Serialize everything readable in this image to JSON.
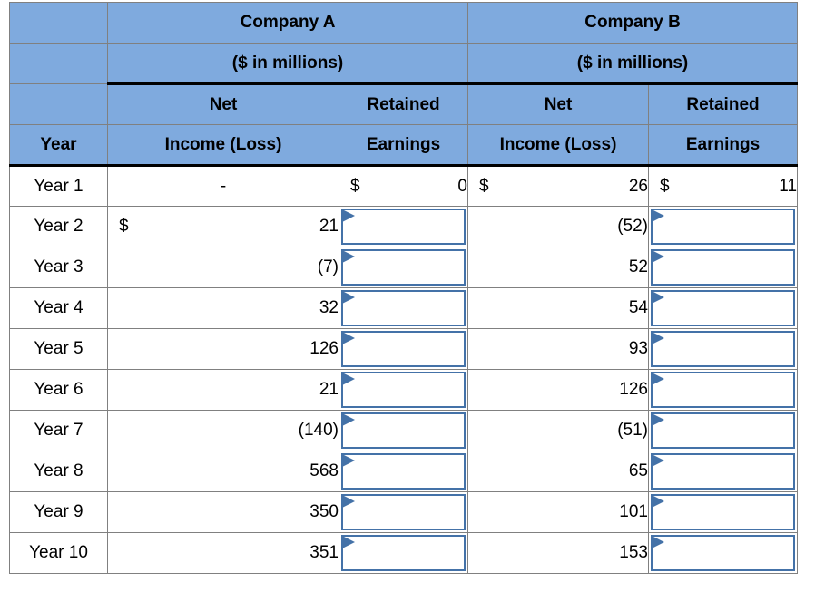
{
  "table": {
    "company_headers": [
      {
        "label": "Company A",
        "colspan": 2
      },
      {
        "label": "Company B",
        "colspan": 2
      }
    ],
    "units_headers": [
      {
        "label": "($ in millions)",
        "colspan": 2
      },
      {
        "label": "($ in millions)",
        "colspan": 2
      }
    ],
    "subheader_line1": [
      "Net",
      "Retained",
      "Net",
      "Retained"
    ],
    "subheader_line2": [
      "Income (Loss)",
      "Earnings",
      "Income (Loss)",
      "Earnings"
    ],
    "year_header": "Year",
    "rows": [
      {
        "year": "Year 1",
        "a_net_income": "-",
        "a_net_income_currency": "",
        "a_net_income_center": true,
        "a_retained": "0",
        "a_retained_currency": "$",
        "a_retained_is_input": false,
        "b_net_income": "26",
        "b_net_income_currency": "$",
        "b_retained": "11",
        "b_retained_currency": "$",
        "b_retained_is_input": false
      },
      {
        "year": "Year 2",
        "a_net_income": "21",
        "a_net_income_currency": "$",
        "a_net_income_center": false,
        "a_retained": "",
        "a_retained_currency": "",
        "a_retained_is_input": true,
        "b_net_income": "(52)",
        "b_net_income_currency": "",
        "b_retained": "",
        "b_retained_currency": "",
        "b_retained_is_input": true
      },
      {
        "year": "Year 3",
        "a_net_income": "(7)",
        "a_net_income_currency": "",
        "a_net_income_center": false,
        "a_retained": "",
        "a_retained_currency": "",
        "a_retained_is_input": true,
        "b_net_income": "52",
        "b_net_income_currency": "",
        "b_retained": "",
        "b_retained_currency": "",
        "b_retained_is_input": true
      },
      {
        "year": "Year 4",
        "a_net_income": "32",
        "a_net_income_currency": "",
        "a_net_income_center": false,
        "a_retained": "",
        "a_retained_currency": "",
        "a_retained_is_input": true,
        "b_net_income": "54",
        "b_net_income_currency": "",
        "b_retained": "",
        "b_retained_currency": "",
        "b_retained_is_input": true
      },
      {
        "year": "Year 5",
        "a_net_income": "126",
        "a_net_income_currency": "",
        "a_net_income_center": false,
        "a_retained": "",
        "a_retained_currency": "",
        "a_retained_is_input": true,
        "b_net_income": "93",
        "b_net_income_currency": "",
        "b_retained": "",
        "b_retained_currency": "",
        "b_retained_is_input": true
      },
      {
        "year": "Year 6",
        "a_net_income": "21",
        "a_net_income_currency": "",
        "a_net_income_center": false,
        "a_retained": "",
        "a_retained_currency": "",
        "a_retained_is_input": true,
        "b_net_income": "126",
        "b_net_income_currency": "",
        "b_retained": "",
        "b_retained_currency": "",
        "b_retained_is_input": true
      },
      {
        "year": "Year 7",
        "a_net_income": "(140)",
        "a_net_income_currency": "",
        "a_net_income_center": false,
        "a_retained": "",
        "a_retained_currency": "",
        "a_retained_is_input": true,
        "b_net_income": "(51)",
        "b_net_income_currency": "",
        "b_retained": "",
        "b_retained_currency": "",
        "b_retained_is_input": true
      },
      {
        "year": "Year 8",
        "a_net_income": "568",
        "a_net_income_currency": "",
        "a_net_income_center": false,
        "a_retained": "",
        "a_retained_currency": "",
        "a_retained_is_input": true,
        "b_net_income": "65",
        "b_net_income_currency": "",
        "b_retained": "",
        "b_retained_currency": "",
        "b_retained_is_input": true
      },
      {
        "year": "Year 9",
        "a_net_income": "350",
        "a_net_income_currency": "",
        "a_net_income_center": false,
        "a_retained": "",
        "a_retained_currency": "",
        "a_retained_is_input": true,
        "b_net_income": "101",
        "b_net_income_currency": "",
        "b_retained": "",
        "b_retained_currency": "",
        "b_retained_is_input": true
      },
      {
        "year": "Year 10",
        "a_net_income": "351",
        "a_net_income_currency": "",
        "a_net_income_center": false,
        "a_retained": "",
        "a_retained_currency": "",
        "a_retained_is_input": true,
        "b_net_income": "153",
        "b_net_income_currency": "",
        "b_retained": "",
        "b_retained_currency": "",
        "b_retained_is_input": true
      }
    ]
  },
  "colors": {
    "header_fill": "#7FAADE",
    "grid_line": "#808080",
    "rule": "#000000",
    "input_border": "#4472A8",
    "input_flag": "#4472A8"
  }
}
